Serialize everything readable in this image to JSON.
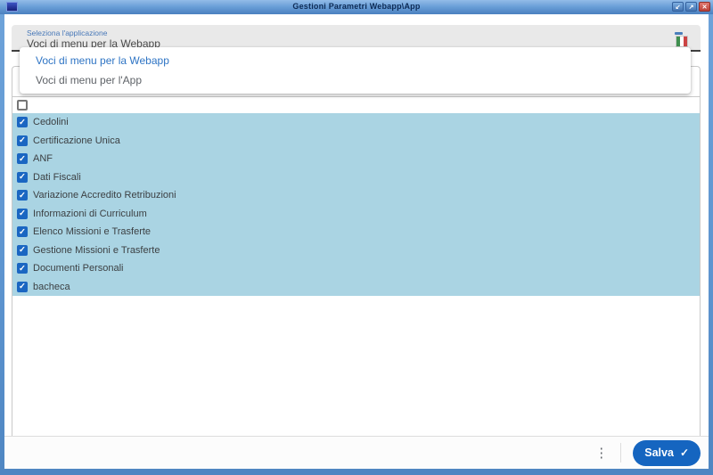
{
  "window": {
    "title": "Gestioni Parametri Webapp\\App",
    "controls": {
      "restore_glyph": "↙",
      "maximize_glyph": "↗",
      "close_glyph": "✕"
    }
  },
  "form": {
    "label": "Seleziona l'applicazione",
    "value": "Voci di menu per la Webapp",
    "flag_icon": "italian-flag-icon"
  },
  "dropdown": {
    "options": [
      {
        "label": "Voci di menu per la Webapp",
        "selected": true
      },
      {
        "label": "Voci di menu per l'App",
        "selected": false
      }
    ]
  },
  "list": {
    "select_all": {
      "checked": false
    },
    "items": [
      {
        "label": "Cedolini",
        "checked": true
      },
      {
        "label": "Certificazione Unica",
        "checked": true
      },
      {
        "label": "ANF",
        "checked": true
      },
      {
        "label": "Dati Fiscali",
        "checked": true
      },
      {
        "label": "Variazione Accredito Retribuzioni",
        "checked": true
      },
      {
        "label": "Informazioni di Curriculum",
        "checked": true
      },
      {
        "label": "Elenco Missioni e Trasferte",
        "checked": true
      },
      {
        "label": "Gestione Missioni e Trasferte",
        "checked": true
      },
      {
        "label": "Documenti Personali",
        "checked": true
      },
      {
        "label": "bacheca",
        "checked": true
      }
    ]
  },
  "footer": {
    "kebab_glyph": "⋮",
    "save_label": "Salva",
    "save_check_glyph": "✓"
  },
  "colors": {
    "accent_blue": "#1a66c2",
    "list_highlight": "#aad4e3",
    "save_button": "#1565c0",
    "close_button": "#bb4038",
    "titlebar_blue": "#4a80bf"
  }
}
